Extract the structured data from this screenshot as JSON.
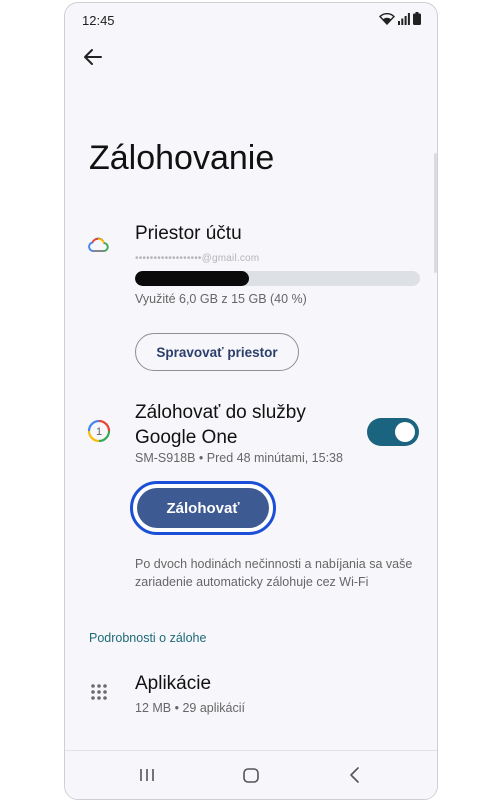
{
  "status_bar": {
    "time": "12:45"
  },
  "header": {
    "title": "Zálohovanie"
  },
  "account_storage": {
    "title": "Priestor účtu",
    "email": "••••••••••••••••••@gmail.com",
    "usage_text": "Využité 6,0 GB z 15 GB (40 %)",
    "usage_fraction": 0.4,
    "manage_button": "Spravovať priestor"
  },
  "google_one": {
    "title_line1": "Zálohovať do služby",
    "title_line2": "Google One",
    "subtitle": "SM-S918B • Pred 48 minútami, 15:38",
    "toggle_on": true,
    "backup_button": "Zálohovať",
    "note": "Po dvoch hodinách nečinnosti a nabíjania sa vaše zariadenie automaticky zálohuje cez Wi-Fi"
  },
  "details": {
    "section_title": "Podrobnosti o zálohe",
    "apps_title": "Aplikácie",
    "apps_subtitle": "12 MB • 29 aplikácií"
  },
  "colors": {
    "accent": "#1a6480",
    "primary_button": "#3e5a93",
    "focus_ring": "#1b4fd8"
  },
  "icons": [
    "back-arrow-icon",
    "cloud-icon",
    "google-one-icon",
    "apps-grid-icon",
    "recents-icon",
    "home-icon",
    "back-icon",
    "wifi-icon",
    "signal-icon",
    "battery-icon"
  ]
}
